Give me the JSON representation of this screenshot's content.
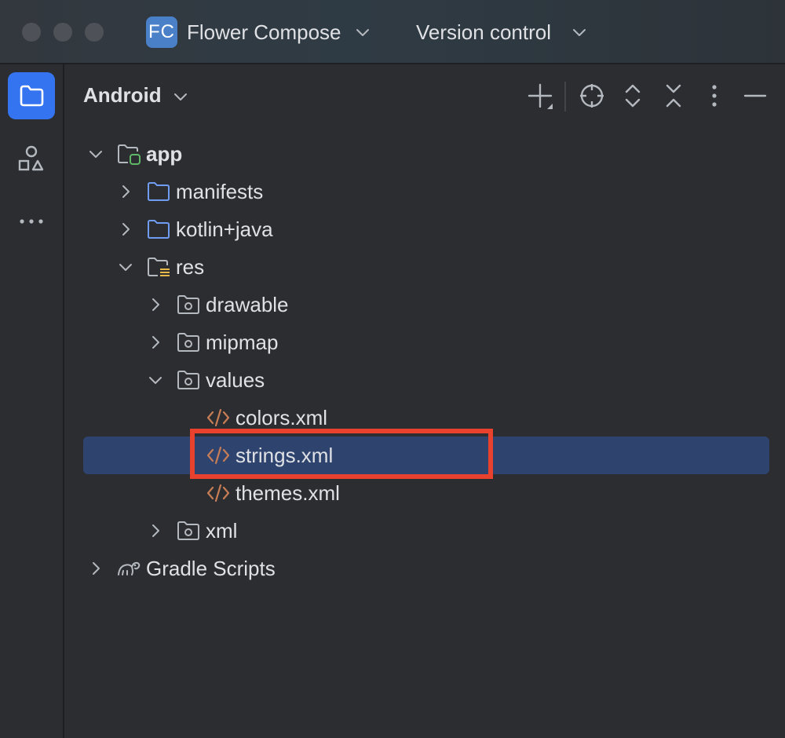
{
  "titlebar": {
    "project_badge": "FC",
    "project_name": "Flower Compose",
    "version_control": "Version control"
  },
  "toolstrip": {
    "items": [
      {
        "icon": "folder-icon",
        "active": true
      },
      {
        "icon": "shapes-icon",
        "active": false
      },
      {
        "icon": "more-horizontal-icon",
        "active": false
      }
    ]
  },
  "panel": {
    "view_mode": "Android",
    "header_icons": [
      "add-icon",
      "locate-icon",
      "expand-all-icon",
      "collapse-all-icon",
      "more-vertical-icon",
      "hide-icon"
    ]
  },
  "tree": [
    {
      "label": "app",
      "expanded": true,
      "icon": "module-folder-icon",
      "bold": true
    },
    {
      "label": "manifests",
      "expanded": false,
      "icon": "folder-icon"
    },
    {
      "label": "kotlin+java",
      "expanded": false,
      "icon": "folder-icon"
    },
    {
      "label": "res",
      "expanded": true,
      "icon": "resource-folder-icon"
    },
    {
      "label": "drawable",
      "expanded": false,
      "icon": "package-folder-icon"
    },
    {
      "label": "mipmap",
      "expanded": false,
      "icon": "package-folder-icon"
    },
    {
      "label": "values",
      "expanded": true,
      "icon": "package-folder-icon"
    },
    {
      "label": "colors.xml",
      "icon": "xml-file-icon"
    },
    {
      "label": "strings.xml",
      "icon": "xml-file-icon",
      "selected": true
    },
    {
      "label": "themes.xml",
      "icon": "xml-file-icon"
    },
    {
      "label": "xml",
      "expanded": false,
      "icon": "package-folder-icon"
    },
    {
      "label": "Gradle Scripts",
      "expanded": false,
      "icon": "gradle-icon"
    }
  ],
  "colors": {
    "background": "#2b2d30",
    "selection": "#2e436e",
    "accent": "#3574f0",
    "highlight_box": "#e8412e",
    "xml_icon": "#c77d55"
  }
}
